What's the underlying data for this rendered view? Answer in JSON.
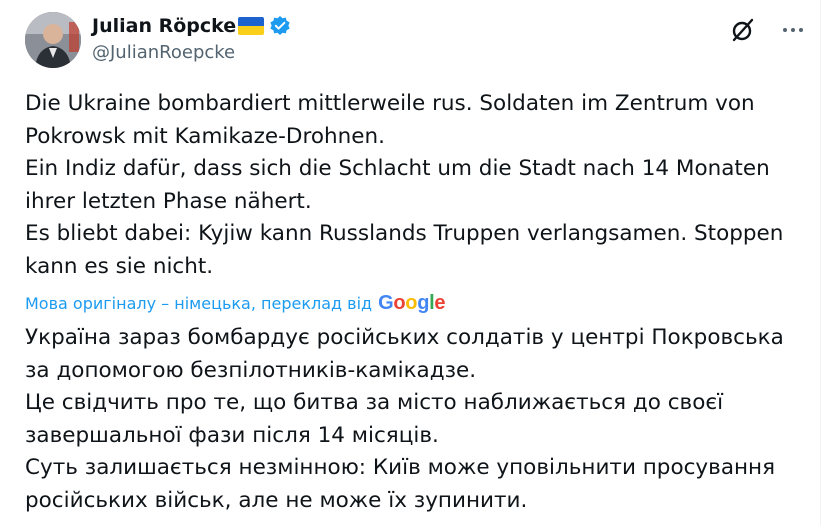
{
  "author": {
    "display_name": "Julian Röpcke",
    "handle": "@JulianRoepcke",
    "verified_icon": "verified-badge-icon",
    "flag": "ukraine-flag"
  },
  "actions": {
    "grok_icon": "grok-icon",
    "more_icon": "more-icon"
  },
  "tweet": {
    "original_lines": [
      "Die Ukraine bombardiert mittlerweile rus. Soldaten im Zentrum von Pokrowsk mit Kamikaze-Drohnen.",
      "Ein Indiz dafür, dass sich die Schlacht um die Stadt nach 14 Monaten ihrer letzten Phase nähert.",
      "Es bliebt dabei: Kyjiw kann Russlands Truppen verlangsamen. Stoppen kann es sie nicht."
    ],
    "translation_note": "Мова оригіналу – німецька, переклад від",
    "translation_provider": "Google",
    "translated_lines": [
      "Україна зараз бомбардує російських солдатів у центрі Покровська за допомогою безпілотників-камікадзе.",
      "Це свідчить про те, що битва за місто наближається до своєї завершальної фази після 14 місяців.",
      "Суть залишається незмінною: Київ може уповільнити просування російських військ, але не може їх зупинити."
    ]
  },
  "colors": {
    "link_blue": "#1d9bf0",
    "text": "#0f1419",
    "secondary": "#536471"
  }
}
